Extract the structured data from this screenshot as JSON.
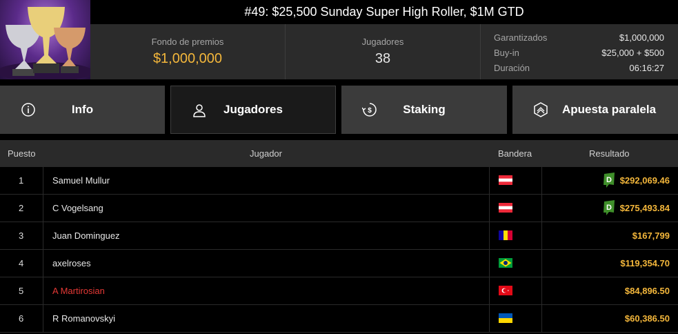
{
  "header": {
    "title": "#49: $25,500 Sunday Super High Roller, $1M GTD",
    "prize_pool_label": "Fondo de premios",
    "prize_pool_value": "$1,000,000",
    "players_label": "Jugadores",
    "players_value": "38",
    "details": [
      {
        "key": "Garantizados",
        "value": "$1,000,000"
      },
      {
        "key": "Buy-in",
        "value": "$25,000 + $500"
      },
      {
        "key": "Duración",
        "value": "06:16:27"
      }
    ]
  },
  "tabs": [
    {
      "label": "Info",
      "icon": "info-icon"
    },
    {
      "label": "Jugadores",
      "icon": "user-icon"
    },
    {
      "label": "Staking",
      "icon": "staking-icon"
    },
    {
      "label": "Apuesta paralela",
      "icon": "side-bet-icon"
    }
  ],
  "table": {
    "columns": [
      "Puesto",
      "Jugador",
      "Bandera",
      "Resultado"
    ],
    "rows": [
      {
        "pos": "1",
        "name": "Samuel Mullur",
        "flag": "Austria",
        "result": "$292,069.46",
        "badge": true
      },
      {
        "pos": "2",
        "name": "C Vogelsang",
        "flag": "Austria",
        "result": "$275,493.84",
        "badge": true
      },
      {
        "pos": "3",
        "name": "Juan Dominguez",
        "flag": "Andorra",
        "result": "$167,799",
        "badge": false
      },
      {
        "pos": "4",
        "name": "axelroses",
        "flag": "Brazil",
        "result": "$119,354.70",
        "badge": false
      },
      {
        "pos": "5",
        "name": "A Martirosian",
        "flag": "Turkey",
        "result": "$84,896.50",
        "badge": false,
        "highlight": true
      },
      {
        "pos": "6",
        "name": "R Romanovskyi",
        "flag": "Ukraine",
        "result": "$60,386.50",
        "badge": false
      }
    ]
  },
  "colors": {
    "accent_gold": "#f4b73b",
    "highlight_red": "#e53935",
    "badge_green": "#3f8f2a"
  }
}
